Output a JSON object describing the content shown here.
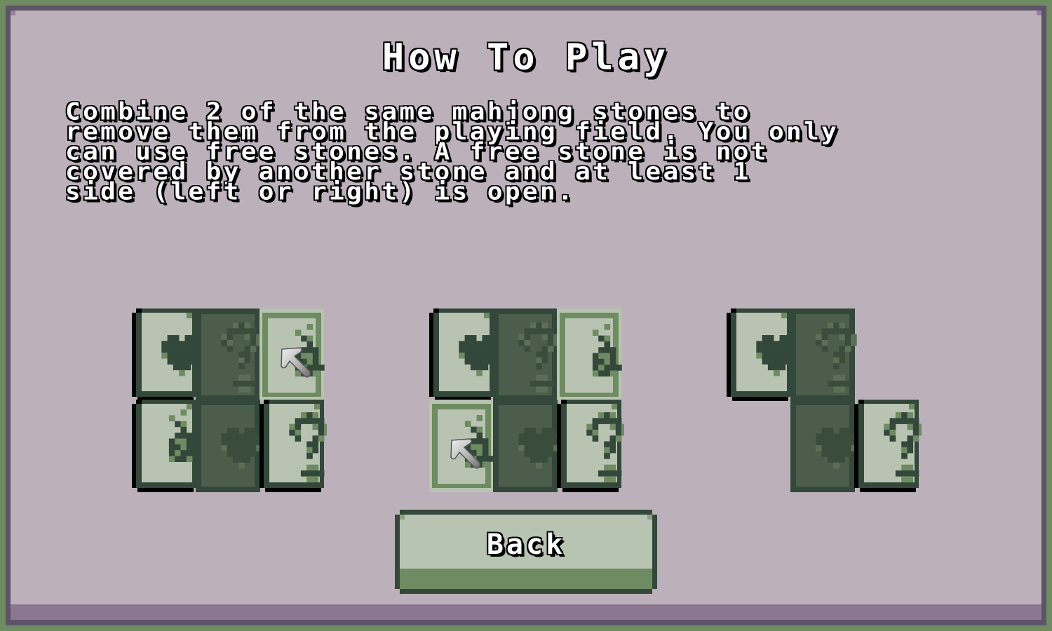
{
  "screen": {
    "title": "How To Play",
    "description": "Combine 2 of the same mahjong stones to\nremove them from the playing field. You only\ncan use free stones. A free stone is not\ncovered by another stone and at least 1\nside (left or right) is open.",
    "back_label": "Back"
  },
  "colors": {
    "outer_border": "#6e8b62",
    "frame": "#5e5468",
    "panel": "#bcb1ba",
    "panel_strip": "#8b7790",
    "tile_face": "#b8c4b1",
    "tile_dark_face": "#4c5e4b",
    "tile_border": "#33483a",
    "tile_accent": "#6e8b62",
    "tile_shadow": "#000000",
    "button_face": "#b7c4b1",
    "button_bottom": "#6e8b62"
  },
  "examples": [
    {
      "name": "example-1",
      "tiles": [
        {
          "row": 0,
          "col": 0,
          "symbol": "heart",
          "state": "free"
        },
        {
          "row": 0,
          "col": 1,
          "symbol": "question",
          "state": "blocked"
        },
        {
          "row": 0,
          "col": 2,
          "symbol": "bomb",
          "state": "selected",
          "cursor": true
        },
        {
          "row": 1,
          "col": 0,
          "symbol": "bomb",
          "state": "free"
        },
        {
          "row": 1,
          "col": 1,
          "symbol": "heart",
          "state": "blocked"
        },
        {
          "row": 1,
          "col": 2,
          "symbol": "question",
          "state": "free"
        }
      ]
    },
    {
      "name": "example-2",
      "tiles": [
        {
          "row": 0,
          "col": 0,
          "symbol": "heart",
          "state": "free"
        },
        {
          "row": 0,
          "col": 1,
          "symbol": "question",
          "state": "blocked"
        },
        {
          "row": 0,
          "col": 2,
          "symbol": "bomb",
          "state": "selected"
        },
        {
          "row": 1,
          "col": 0,
          "symbol": "bomb",
          "state": "selected",
          "cursor": true
        },
        {
          "row": 1,
          "col": 1,
          "symbol": "heart",
          "state": "blocked"
        },
        {
          "row": 1,
          "col": 2,
          "symbol": "question",
          "state": "free"
        }
      ]
    },
    {
      "name": "example-3",
      "tiles": [
        {
          "row": 0,
          "col": 0,
          "symbol": "heart",
          "state": "free"
        },
        {
          "row": 0,
          "col": 1,
          "symbol": "question",
          "state": "blocked"
        },
        {
          "row": 1,
          "col": 1,
          "symbol": "heart",
          "state": "blocked"
        },
        {
          "row": 1,
          "col": 2,
          "symbol": "question",
          "state": "free"
        }
      ]
    }
  ]
}
